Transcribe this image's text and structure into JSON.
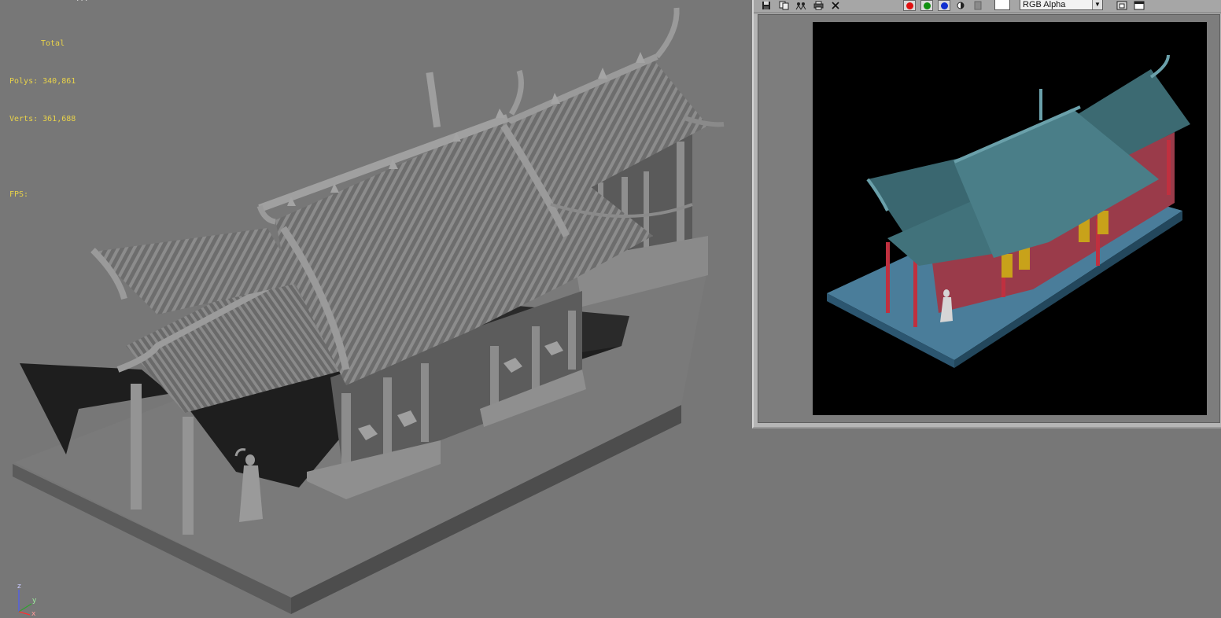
{
  "viewport": {
    "top_cut_text": "...",
    "stats": {
      "total_label": "Total",
      "polys": "Polys: 340,861",
      "verts": "Verts: 361,688",
      "fps": "FPS:"
    },
    "axis": {
      "z": "z",
      "y": "y",
      "x": "x"
    },
    "colors": {
      "background": "#777777",
      "stats_text": "#e8d24a"
    }
  },
  "render_window": {
    "toolbar": {
      "icons": [
        "save-icon",
        "copy-icon",
        "clone-icon",
        "print-icon",
        "clear-icon"
      ],
      "channels": [
        {
          "name": "red-channel-icon",
          "color": "#e01010"
        },
        {
          "name": "green-channel-icon",
          "color": "#109010"
        },
        {
          "name": "blue-channel-icon",
          "color": "#1030d0"
        }
      ],
      "display_channel": "RGB Alpha",
      "window_icons": [
        "restore-icon",
        "maximize-icon"
      ]
    },
    "colors": {
      "frame": "#b5b5b5",
      "canvas": "#000000"
    }
  }
}
